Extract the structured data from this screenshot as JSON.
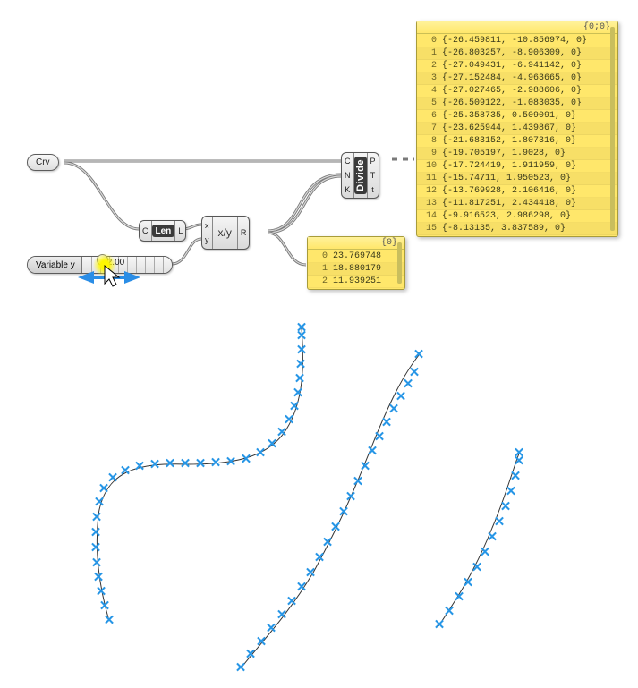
{
  "crv": {
    "label": "Crv"
  },
  "len": {
    "in": "C",
    "label": "Len",
    "out": "L"
  },
  "div": {
    "in_x": "x",
    "in_y": "y",
    "label": "x/y",
    "out": "R"
  },
  "divide": {
    "in_c": "C",
    "in_n": "N",
    "in_k": "K",
    "label": "Divide",
    "out_p": "P",
    "out_t": "T",
    "out_tt": "t"
  },
  "slider": {
    "label": "Variable y",
    "value": "2.00"
  },
  "panel_r": {
    "header": "{0}",
    "rows": [
      {
        "idx": "0",
        "val": "23.769748"
      },
      {
        "idx": "1",
        "val": "18.880179"
      },
      {
        "idx": "2",
        "val": "11.939251"
      }
    ]
  },
  "panel_p": {
    "header": "{0;0}",
    "rows": [
      {
        "idx": "0",
        "val": "{-26.459811, -10.856974, 0}"
      },
      {
        "idx": "1",
        "val": "{-26.803257, -8.906309, 0}"
      },
      {
        "idx": "2",
        "val": "{-27.049431, -6.941142, 0}"
      },
      {
        "idx": "3",
        "val": "{-27.152484, -4.963665, 0}"
      },
      {
        "idx": "4",
        "val": "{-27.027465, -2.988606, 0}"
      },
      {
        "idx": "5",
        "val": "{-26.509122, -1.083035, 0}"
      },
      {
        "idx": "6",
        "val": "{-25.358735, 0.509091, 0}"
      },
      {
        "idx": "7",
        "val": "{-23.625944, 1.439867, 0}"
      },
      {
        "idx": "8",
        "val": "{-21.683152, 1.807316, 0}"
      },
      {
        "idx": "9",
        "val": "{-19.705197, 1.9028, 0}"
      },
      {
        "idx": "10",
        "val": "{-17.724419, 1.911959, 0}"
      },
      {
        "idx": "11",
        "val": "{-15.74711, 1.950523, 0}"
      },
      {
        "idx": "12",
        "val": "{-13.769928, 2.106416, 0}"
      },
      {
        "idx": "13",
        "val": "{-11.817251, 2.434418, 0}"
      },
      {
        "idx": "14",
        "val": "{-9.916523, 2.986298, 0}"
      },
      {
        "idx": "15",
        "val": "{-8.13135, 3.837589, 0}"
      }
    ]
  }
}
